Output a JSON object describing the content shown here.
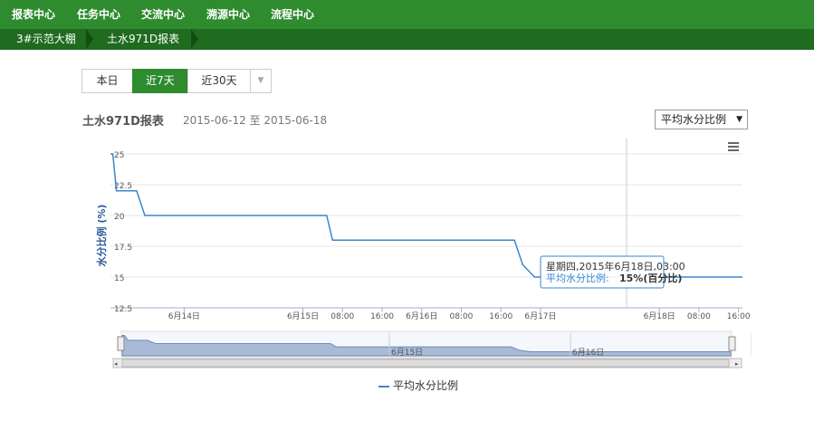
{
  "nav": {
    "items": [
      "报表中心",
      "任务中心",
      "交流中心",
      "溯源中心",
      "流程中心"
    ]
  },
  "breadcrumb": [
    "3#示范大棚",
    "土水971D报表"
  ],
  "range_buttons": {
    "today": "本日",
    "week": "近7天",
    "month": "近30天",
    "active": "近7天"
  },
  "report": {
    "title": "土水971D报表",
    "date_range": "2015-06-12 至 2015-06-18",
    "metric_select": "平均水分比例"
  },
  "colors": {
    "nav": "#2e8b2e",
    "crumb": "#1f6b1f",
    "series": "#3a86d1"
  },
  "icons": {
    "menu": "menu-icon",
    "caret": "caret-down-icon"
  },
  "tooltip": {
    "line1": "星期四,2015年6月18日,03:00",
    "series_label": "平均水分比例:",
    "value_text": "15%(百分比)"
  },
  "chart_data": {
    "type": "line",
    "ylabel": "水分比例 (%)",
    "ylim": [
      12.5,
      25
    ],
    "yticks": [
      "25",
      "22.5",
      "20",
      "17.5",
      "15",
      "12.5"
    ],
    "xticks": [
      {
        "t": 1.5,
        "label": "6月14日"
      },
      {
        "t": 2.5,
        "label": "6月15日"
      },
      {
        "t": 2.833,
        "label": "08:00"
      },
      {
        "t": 3.167,
        "label": "16:00"
      },
      {
        "t": 3.5,
        "label": "6月16日"
      },
      {
        "t": 3.833,
        "label": "08:00"
      },
      {
        "t": 4.167,
        "label": "16:00"
      },
      {
        "t": 4.5,
        "label": "6月17日"
      },
      {
        "t": 5.5,
        "label": "6月18日"
      },
      {
        "t": 5.833,
        "label": "08:00"
      },
      {
        "t": 6.167,
        "label": "16:00"
      }
    ],
    "series": [
      {
        "name": "平均水分比例",
        "points": [
          [
            0.88,
            25
          ],
          [
            0.9,
            25
          ],
          [
            0.93,
            22
          ],
          [
            1.1,
            22
          ],
          [
            1.17,
            20
          ],
          [
            2.7,
            20
          ],
          [
            2.75,
            18
          ],
          [
            4.28,
            18
          ],
          [
            4.35,
            16
          ],
          [
            4.45,
            15
          ],
          [
            6.2,
            15
          ]
        ]
      }
    ],
    "navigator_ticks": [
      {
        "t": 1.0,
        "label": "6月15日"
      },
      {
        "t": 2.0,
        "label": "6月16日"
      },
      {
        "t": 3.0,
        "label": "6月18日"
      }
    ],
    "legend": "平均水分比例"
  }
}
